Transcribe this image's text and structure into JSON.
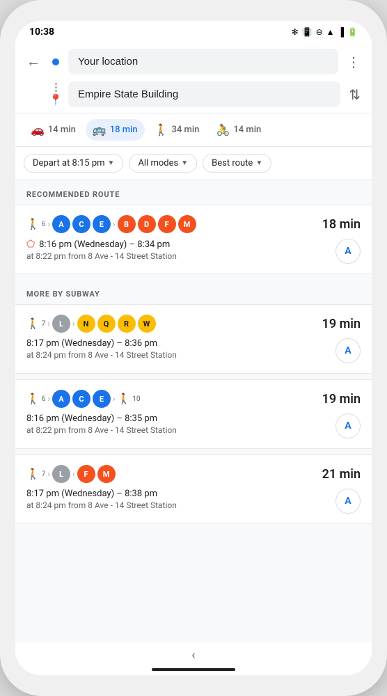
{
  "status": {
    "time": "10:38",
    "icons": [
      "signal-icon",
      "vibrate-icon",
      "minus-circle-icon",
      "wifi-icon",
      "signal-bars-icon",
      "battery-icon"
    ]
  },
  "header": {
    "back_label": "←",
    "origin_placeholder": "Your location",
    "destination_placeholder": "Empire State Building",
    "more_label": "⋮",
    "swap_label": "⇅"
  },
  "mode_tabs": [
    {
      "icon": "🚗",
      "label": "14 min",
      "active": false
    },
    {
      "icon": "🚌",
      "label": "18 min",
      "active": true
    },
    {
      "icon": "🚶",
      "label": "34 min",
      "active": false
    },
    {
      "icon": "🚲",
      "label": "14 min",
      "active": false
    }
  ],
  "filters": [
    {
      "label": "Depart at 8:15 pm",
      "has_arrow": true
    },
    {
      "label": "All modes",
      "has_arrow": true
    },
    {
      "label": "Best route",
      "has_arrow": true
    }
  ],
  "recommended_section": {
    "label": "RECOMMENDED ROUTE",
    "route": {
      "walk_start": "6",
      "lines": [
        "A",
        "C",
        "E",
        "B",
        "D",
        "F",
        "M"
      ],
      "line_groups": [
        {
          "letters": [
            "A",
            "C",
            "E"
          ],
          "color": "#1a73e8"
        },
        {
          "letters": [
            "B",
            "D",
            "F",
            "M"
          ],
          "color": "#f4511e"
        }
      ],
      "duration": "18 min",
      "alert": true,
      "times": "8:16 pm (Wednesday) – 8:34 pm",
      "from": "at 8:22 pm from 8 Ave - 14 Street Station"
    }
  },
  "subway_section": {
    "label": "MORE BY SUBWAY",
    "routes": [
      {
        "walk_start": "7",
        "lines_pre": [
          {
            "letter": "L",
            "color": "#9aa0a6"
          }
        ],
        "lines_post": [
          {
            "letter": "N",
            "color": "#fbbc04",
            "dark_text": true
          },
          {
            "letter": "Q",
            "color": "#fbbc04",
            "dark_text": true
          },
          {
            "letter": "R",
            "color": "#fbbc04",
            "dark_text": true
          },
          {
            "letter": "W",
            "color": "#fbbc04",
            "dark_text": true
          }
        ],
        "duration": "19 min",
        "times": "8:17 pm (Wednesday) – 8:36 pm",
        "from": "at 8:24 pm from 8 Ave - 14 Street Station"
      },
      {
        "walk_start": "6",
        "lines_pre": [
          {
            "letter": "A",
            "color": "#1a73e8"
          },
          {
            "letter": "C",
            "color": "#1a73e8"
          },
          {
            "letter": "E",
            "color": "#1a73e8"
          }
        ],
        "lines_post": [],
        "walk_end": "10",
        "duration": "19 min",
        "times": "8:16 pm (Wednesday) – 8:35 pm",
        "from": "at 8:22 pm from 8 Ave - 14 Street Station"
      },
      {
        "walk_start": "7",
        "lines_pre": [
          {
            "letter": "L",
            "color": "#9aa0a6"
          }
        ],
        "lines_post": [
          {
            "letter": "F",
            "color": "#f4511e"
          },
          {
            "letter": "M",
            "color": "#f4511e"
          }
        ],
        "duration": "21 min",
        "times": "8:17 pm (Wednesday) – 8:38 pm",
        "from": "at 8:24 pm from 8 Ave - 14 Street Station"
      }
    ]
  },
  "bottom": {
    "back_btn": "‹",
    "home_indicator": true
  }
}
